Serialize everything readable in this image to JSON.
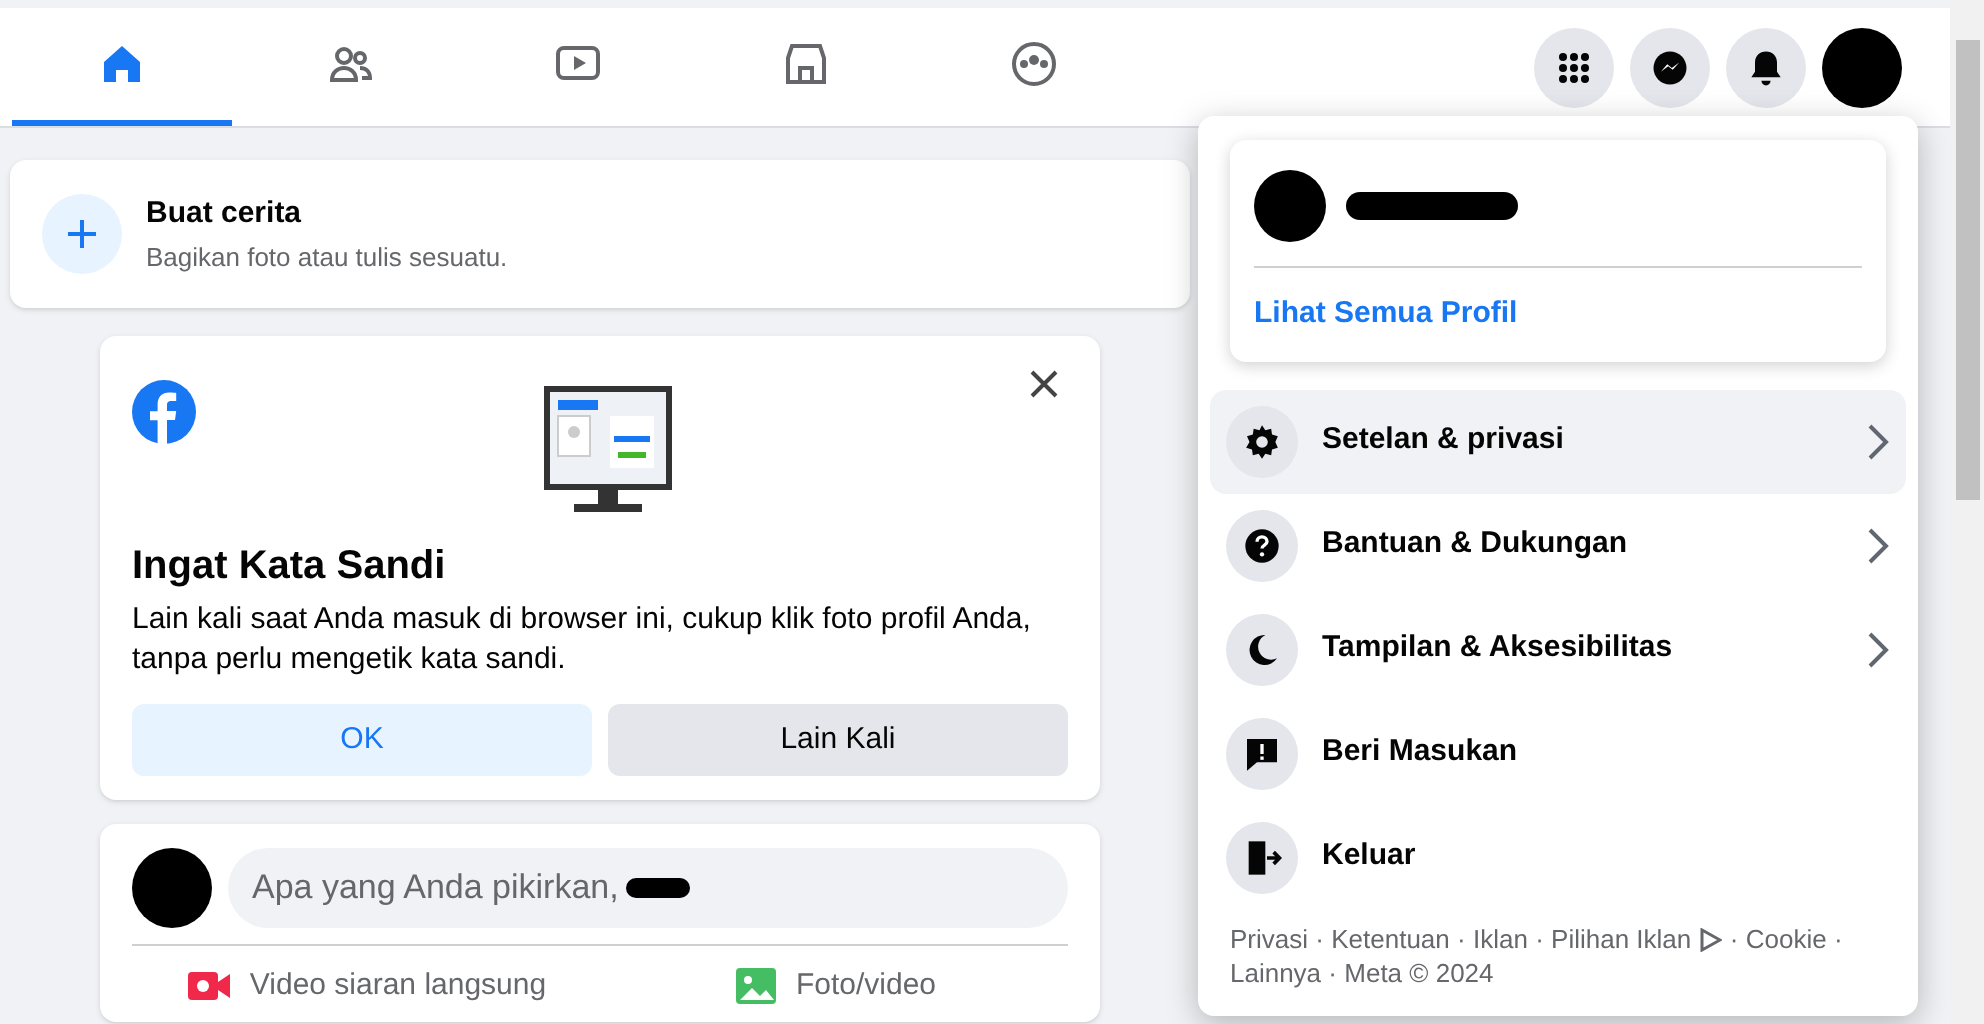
{
  "nav": {
    "tabs": [
      {
        "kind": "home",
        "selected": true
      },
      {
        "kind": "friends",
        "selected": false
      },
      {
        "kind": "video",
        "selected": false
      },
      {
        "kind": "market",
        "selected": false
      },
      {
        "kind": "groups",
        "selected": false
      }
    ],
    "actions": [
      {
        "kind": "menu"
      },
      {
        "kind": "messenger"
      },
      {
        "kind": "bell"
      }
    ]
  },
  "story": {
    "title": "Buat cerita",
    "subtitle": "Bagikan foto atau tulis sesuatu."
  },
  "password_card": {
    "title": "Ingat Kata Sandi",
    "body": "Lain kali saat Anda masuk di browser ini, cukup klik foto profil Anda, tanpa perlu mengetik kata sandi.",
    "buttons": [
      {
        "label": "OK",
        "kind": "primary"
      },
      {
        "label": "Lain Kali",
        "kind": "secondary"
      }
    ]
  },
  "composer": {
    "placeholder": "Apa yang Anda pikirkan,",
    "actions": [
      {
        "label": "Video siaran langsung",
        "kind": "live"
      },
      {
        "label": "Foto/video",
        "kind": "photo"
      }
    ]
  },
  "menu": {
    "profile_link": "Lihat Semua Profil",
    "items": [
      {
        "label": "Setelan & privasi",
        "kind": "gear",
        "has_arrow": true,
        "selected": true
      },
      {
        "label": "Bantuan & Dukungan",
        "kind": "help",
        "has_arrow": true,
        "selected": false
      },
      {
        "label": "Tampilan & Aksesibilitas",
        "kind": "moon",
        "has_arrow": true,
        "selected": false
      },
      {
        "label": "Beri Masukan",
        "kind": "feedback",
        "has_arrow": false,
        "selected": false
      },
      {
        "label": "Keluar",
        "kind": "logout",
        "has_arrow": false,
        "selected": false
      }
    ],
    "footer_separator": "·",
    "footer_links": [
      "Privasi",
      "Ketentuan",
      "Iklan",
      "Pilihan Iklan",
      "Cookie",
      "Lainnya",
      "Meta © 2024"
    ]
  }
}
